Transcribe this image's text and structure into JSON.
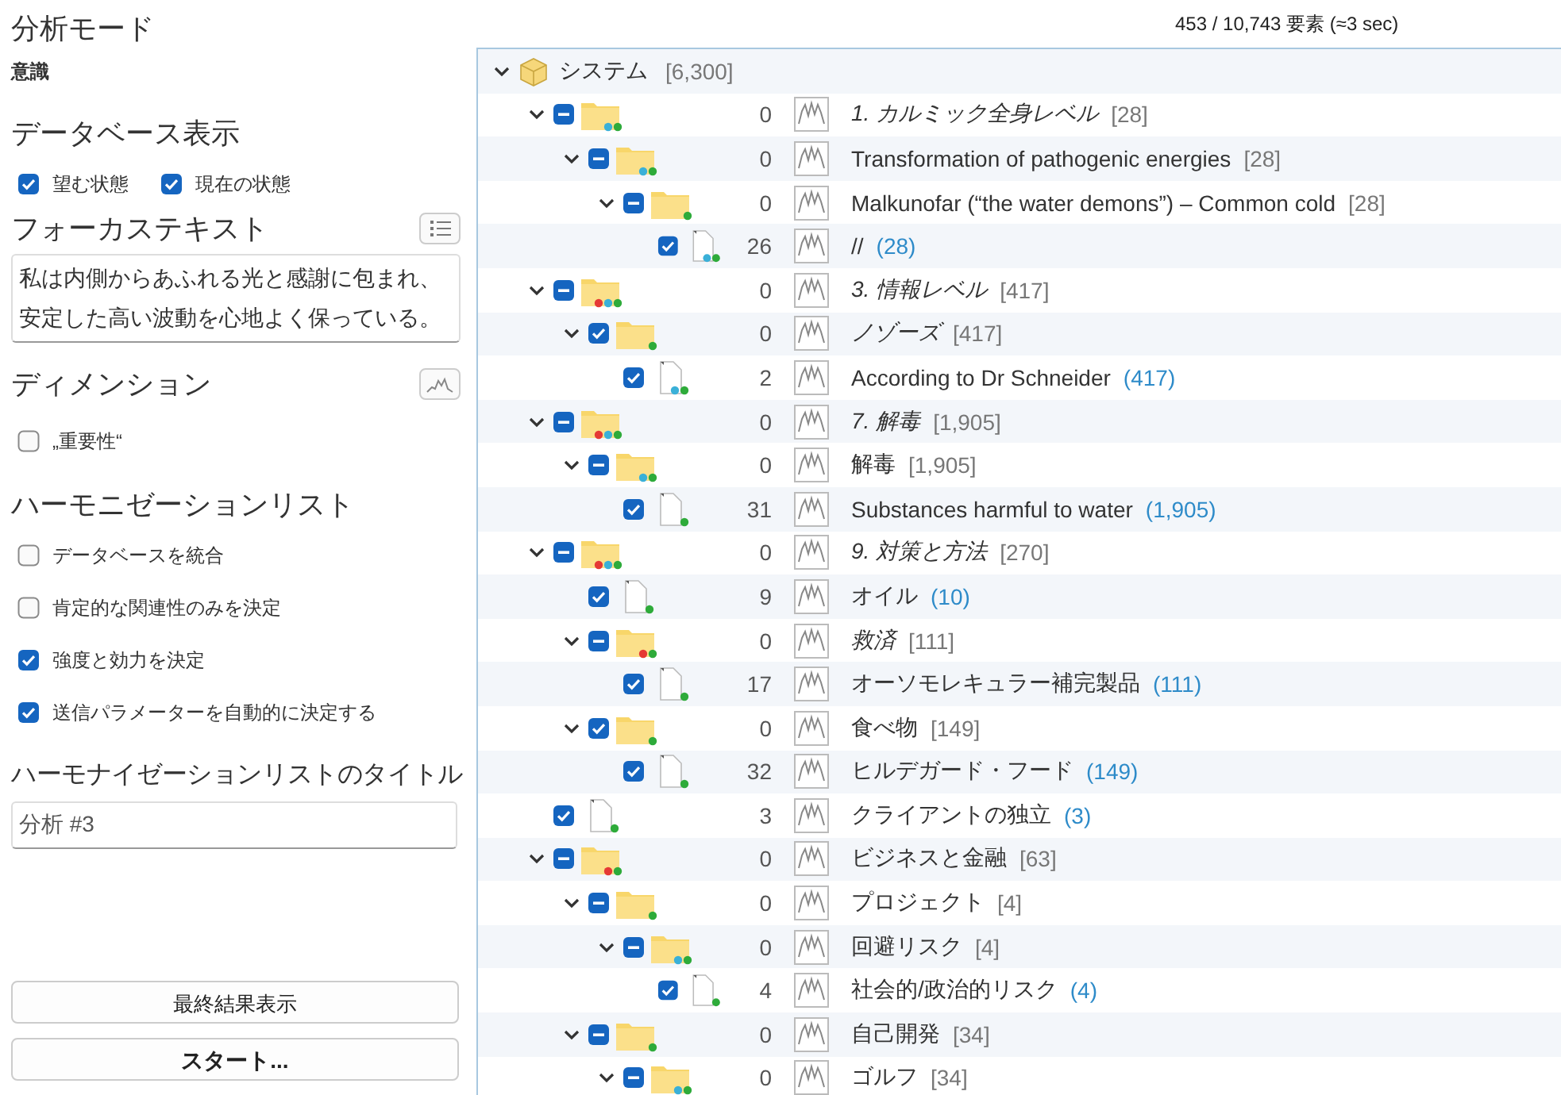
{
  "sidebar": {
    "analysis_mode": {
      "heading": "分析モード",
      "value": "意識"
    },
    "database_view": {
      "heading": "データベース表示",
      "options": [
        {
          "label": "望む状態",
          "checked": true
        },
        {
          "label": "現在の状態",
          "checked": true
        }
      ]
    },
    "focus_text": {
      "heading": "フォーカステキスト",
      "text": "私は内側からあふれる光と感謝に包まれ、安定した高い波動を心地よく保っている。"
    },
    "dimension": {
      "heading": "ディメンション",
      "options": [
        {
          "label": "„重要性“",
          "checked": false
        }
      ]
    },
    "harmonization_list": {
      "heading": "ハーモニゼーションリスト",
      "options": [
        {
          "label": "データベースを統合",
          "checked": false
        },
        {
          "label": "肯定的な関連性のみを決定",
          "checked": false
        },
        {
          "label": "強度と効力を決定",
          "checked": true
        },
        {
          "label": "送信パラメーターを自動的に決定する",
          "checked": true
        }
      ]
    },
    "list_title": {
      "heading": "ハーモナイゼーションリストのタイトル",
      "value": "分析 #3"
    },
    "buttons": [
      {
        "label": "最終結果表示",
        "kind": "normal"
      },
      {
        "label": "スタート...",
        "kind": "primary"
      }
    ]
  },
  "status": "453 / 10,743 要素 (≈3 sec)",
  "tree": {
    "root": {
      "name": "システム",
      "total": "[6,300]",
      "expanded": true,
      "children": [
        {
          "kind": "folder",
          "checked": false,
          "partial": true,
          "expanded": true,
          "italic": true,
          "count": "0",
          "name": "1. カルミック全身レベル",
          "total": "[28]",
          "dots": [
            {
              "color": "#3ab0d8"
            },
            {
              "color": "#2eab3a"
            }
          ],
          "children": [
            {
              "kind": "folder",
              "checked": false,
              "partial": true,
              "expanded": true,
              "italic": false,
              "count": "0",
              "name": "Transformation of pathogenic energies",
              "total": "[28]",
              "dots": [
                {
                  "color": "#3ab0d8"
                },
                {
                  "color": "#2eab3a"
                }
              ],
              "children": [
                {
                  "kind": "folder",
                  "checked": false,
                  "partial": true,
                  "expanded": true,
                  "italic": false,
                  "count": "0",
                  "name": "Malkunofar (“the water demons”) – Common cold",
                  "total": "[28]",
                  "dots": [
                    {
                      "color": "#2eab3a"
                    }
                  ],
                  "children": [
                    {
                      "kind": "file",
                      "checked": true,
                      "partial": false,
                      "italic": false,
                      "count": "26",
                      "name": "//",
                      "total": "(28)",
                      "dots": [
                        {
                          "color": "#3ab0d8"
                        },
                        {
                          "color": "#2eab3a"
                        }
                      ]
                    }
                  ]
                }
              ]
            }
          ]
        },
        {
          "kind": "folder",
          "checked": false,
          "partial": true,
          "expanded": true,
          "italic": true,
          "count": "0",
          "name": "3. 情報レベル",
          "total": "[417]",
          "dots": [
            {
              "color": "#e53935"
            },
            {
              "color": "#3ab0d8"
            },
            {
              "color": "#2eab3a"
            }
          ],
          "children": [
            {
              "kind": "folder",
              "checked": true,
              "partial": false,
              "expanded": true,
              "italic": true,
              "count": "0",
              "name": "ノゾーズ",
              "total": "[417]",
              "dots": [
                {
                  "color": "#2eab3a"
                }
              ],
              "children": [
                {
                  "kind": "file",
                  "checked": true,
                  "partial": false,
                  "italic": false,
                  "count": "2",
                  "name": "According to Dr Schneider",
                  "total": "(417)",
                  "dots": [
                    {
                      "color": "#3ab0d8"
                    },
                    {
                      "color": "#2eab3a"
                    }
                  ]
                }
              ]
            }
          ]
        },
        {
          "kind": "folder",
          "checked": false,
          "partial": true,
          "expanded": true,
          "italic": true,
          "count": "0",
          "name": "7. 解毒",
          "total": "[1,905]",
          "dots": [
            {
              "color": "#e53935"
            },
            {
              "color": "#3ab0d8"
            },
            {
              "color": "#2eab3a"
            }
          ],
          "children": [
            {
              "kind": "folder",
              "checked": false,
              "partial": true,
              "expanded": true,
              "italic": false,
              "count": "0",
              "name": "解毒",
              "total": "[1,905]",
              "dots": [
                {
                  "color": "#3ab0d8"
                },
                {
                  "color": "#2eab3a"
                }
              ],
              "children": [
                {
                  "kind": "file",
                  "checked": true,
                  "partial": false,
                  "italic": false,
                  "count": "31",
                  "name": "Substances harmful to water",
                  "total": "(1,905)",
                  "dots": [
                    {
                      "color": "#2eab3a"
                    }
                  ]
                }
              ]
            }
          ]
        },
        {
          "kind": "folder",
          "checked": false,
          "partial": true,
          "expanded": true,
          "italic": true,
          "count": "0",
          "name": "9. 対策と方法",
          "total": "[270]",
          "dots": [
            {
              "color": "#e53935"
            },
            {
              "color": "#3ab0d8"
            },
            {
              "color": "#2eab3a"
            }
          ],
          "children": [
            {
              "kind": "file",
              "checked": true,
              "partial": false,
              "italic": false,
              "count": "9",
              "name": "オイル",
              "total": "(10)",
              "dots": [
                {
                  "color": "#2eab3a"
                }
              ]
            },
            {
              "kind": "folder",
              "checked": false,
              "partial": true,
              "expanded": true,
              "italic": true,
              "count": "0",
              "name": "救済",
              "total": "[111]",
              "dots": [
                {
                  "color": "#e53935"
                },
                {
                  "color": "#2eab3a"
                }
              ],
              "children": [
                {
                  "kind": "file",
                  "checked": true,
                  "partial": false,
                  "italic": false,
                  "count": "17",
                  "name": "オーソモレキュラー補完製品",
                  "total": "(111)",
                  "dots": [
                    {
                      "color": "#2eab3a"
                    }
                  ]
                }
              ]
            },
            {
              "kind": "folder",
              "checked": true,
              "partial": false,
              "expanded": true,
              "italic": false,
              "count": "0",
              "name": "食べ物",
              "total": "[149]",
              "dots": [
                {
                  "color": "#2eab3a"
                }
              ],
              "children": [
                {
                  "kind": "file",
                  "checked": true,
                  "partial": false,
                  "italic": false,
                  "count": "32",
                  "name": "ヒルデガード・フード",
                  "total": "(149)",
                  "dots": [
                    {
                      "color": "#2eab3a"
                    }
                  ]
                }
              ]
            }
          ]
        },
        {
          "kind": "file",
          "checked": true,
          "partial": false,
          "italic": false,
          "count": "3",
          "name": "クライアントの独立",
          "total": "(3)",
          "dots": [
            {
              "color": "#2eab3a"
            }
          ]
        },
        {
          "kind": "folder",
          "checked": false,
          "partial": true,
          "expanded": true,
          "italic": false,
          "count": "0",
          "name": "ビジネスと金融",
          "total": "[63]",
          "dots": [
            {
              "color": "#e53935"
            },
            {
              "color": "#2eab3a"
            }
          ],
          "children": [
            {
              "kind": "folder",
              "checked": false,
              "partial": true,
              "expanded": true,
              "italic": false,
              "count": "0",
              "name": "プロジェクト",
              "total": "[4]",
              "dots": [
                {
                  "color": "#2eab3a"
                }
              ],
              "children": [
                {
                  "kind": "folder",
                  "checked": false,
                  "partial": true,
                  "expanded": true,
                  "italic": false,
                  "count": "0",
                  "name": "回避リスク",
                  "total": "[4]",
                  "dots": [
                    {
                      "color": "#3ab0d8"
                    },
                    {
                      "color": "#2eab3a"
                    }
                  ],
                  "children": [
                    {
                      "kind": "file",
                      "checked": true,
                      "partial": false,
                      "italic": false,
                      "count": "4",
                      "name": "社会的/政治的リスク",
                      "total": "(4)",
                      "dots": [
                        {
                          "color": "#2eab3a"
                        }
                      ]
                    }
                  ]
                }
              ]
            },
            {
              "kind": "folder",
              "checked": false,
              "partial": true,
              "expanded": true,
              "italic": false,
              "count": "0",
              "name": "自己開発",
              "total": "[34]",
              "dots": [
                {
                  "color": "#2eab3a"
                }
              ],
              "children": [
                {
                  "kind": "folder",
                  "checked": false,
                  "partial": true,
                  "expanded": true,
                  "italic": false,
                  "count": "0",
                  "name": "ゴルフ",
                  "total": "[34]",
                  "dots": [
                    {
                      "color": "#3ab0d8"
                    },
                    {
                      "color": "#2eab3a"
                    }
                  ]
                }
              ]
            }
          ]
        }
      ]
    }
  }
}
